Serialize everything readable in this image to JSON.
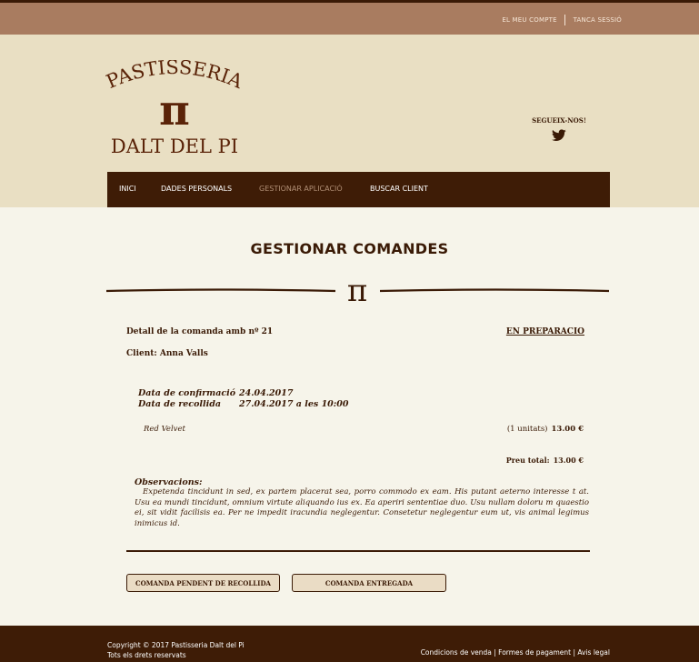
{
  "topbar": {
    "account_link": "EL MEU COMPTE",
    "logout_link": "TANCA SESSIÓ"
  },
  "logo": {
    "line1": "PASTISSERIA",
    "symbol": "π",
    "line2": "DALT DEL PI"
  },
  "social": {
    "label": "SEGUEIX-NOS!",
    "icon": "twitter-icon"
  },
  "nav": {
    "items": [
      {
        "label": "INICI"
      },
      {
        "label": "DADES PERSONALS"
      },
      {
        "label": "GESTIONAR APLICACIÓ"
      },
      {
        "label": "BUSCAR CLIENT"
      }
    ]
  },
  "page": {
    "title": "GESTIONAR COMANDES",
    "divider_symbol": "π"
  },
  "order": {
    "label": "Detall de la comanda amb nº 21",
    "status": "EN PREPARACIO",
    "client": "Client: Anna Valls",
    "confirmation_label": "Data de confirmació",
    "confirmation_value": "24.04.2017",
    "pickup_label": "Data de recollida",
    "pickup_value": "27.04.2017 a les 10:00",
    "product_name": "Red Velvet",
    "product_units": "(1 unitats)",
    "product_price": "13.00 €",
    "total_label": "Preu total:",
    "total_value": "13.00 €",
    "observations_title": "Observacions:",
    "observations_text": "Expetenda tincidunt in sed, ex partem placerat sea, porro commodo ex eam. His putant aeterno interesse t at. Usu ea mundi tincidunt, omnium virtute aliquando ius ex. Ea aperiri sententiae duo. Usu nullam doloru m quaestio ei, sit vidit facilisis ea. Per ne impedit iracundia neglegentur. Consetetur neglegentur eum ut, vis animal legimus inimicus id."
  },
  "buttons": {
    "pending": "COMANDA PENDENT DE RECOLLIDA",
    "delivered": "COMANDA ENTREGADA"
  },
  "footer": {
    "copyright": "Copyright © 2017 Pastisseria Dalt del Pi",
    "rights": "Tots els drets reservats",
    "links": "Condicions de venda | Formes de pagament | Avis legal"
  },
  "colors": {
    "topbar": "#a97c60",
    "header": "#e9dfc3",
    "dark_brown": "#3e1c06",
    "page_bg": "#f6f4ea"
  }
}
